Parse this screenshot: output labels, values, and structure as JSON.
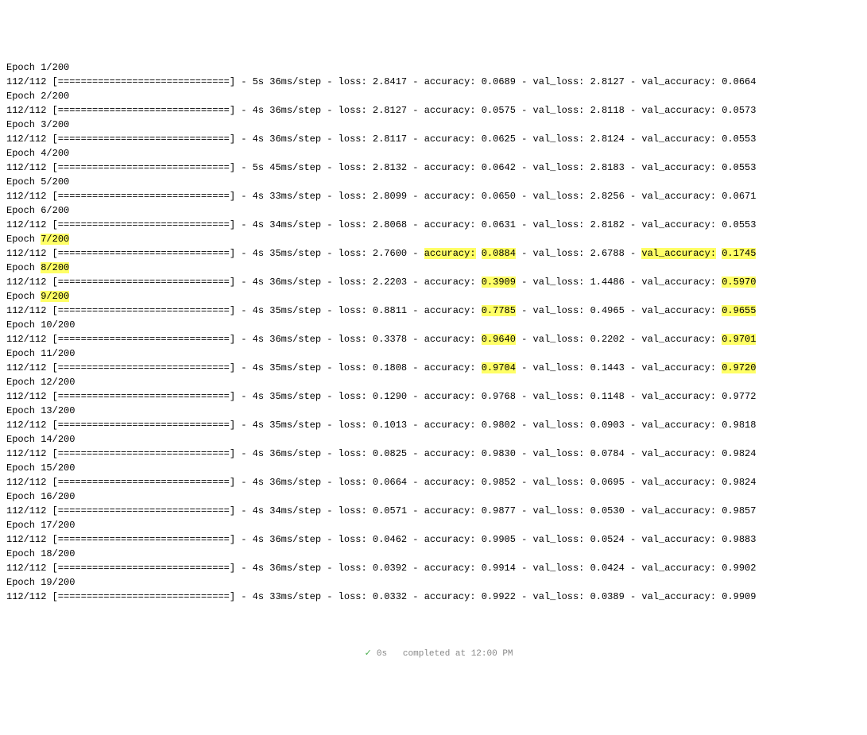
{
  "total_epochs": 200,
  "epochs": [
    {
      "n": 1,
      "hl_epoch": false,
      "progress": "112/112 [==============================]",
      "time": "5s 36ms/step",
      "loss": "2.8417",
      "acc": "0.0689",
      "val_loss": "2.8127",
      "val_acc": "0.0664",
      "hl_acc_label": false,
      "hl_acc": false,
      "hl_val_label": false,
      "hl_val": false
    },
    {
      "n": 2,
      "hl_epoch": false,
      "progress": "112/112 [==============================]",
      "time": "4s 36ms/step",
      "loss": "2.8127",
      "acc": "0.0575",
      "val_loss": "2.8118",
      "val_acc": "0.0573",
      "hl_acc_label": false,
      "hl_acc": false,
      "hl_val_label": false,
      "hl_val": false
    },
    {
      "n": 3,
      "hl_epoch": false,
      "progress": "112/112 [==============================]",
      "time": "4s 36ms/step",
      "loss": "2.8117",
      "acc": "0.0625",
      "val_loss": "2.8124",
      "val_acc": "0.0553",
      "hl_acc_label": false,
      "hl_acc": false,
      "hl_val_label": false,
      "hl_val": false
    },
    {
      "n": 4,
      "hl_epoch": false,
      "progress": "112/112 [==============================]",
      "time": "5s 45ms/step",
      "loss": "2.8132",
      "acc": "0.0642",
      "val_loss": "2.8183",
      "val_acc": "0.0553",
      "hl_acc_label": false,
      "hl_acc": false,
      "hl_val_label": false,
      "hl_val": false
    },
    {
      "n": 5,
      "hl_epoch": false,
      "progress": "112/112 [==============================]",
      "time": "4s 33ms/step",
      "loss": "2.8099",
      "acc": "0.0650",
      "val_loss": "2.8256",
      "val_acc": "0.0671",
      "hl_acc_label": false,
      "hl_acc": false,
      "hl_val_label": false,
      "hl_val": false
    },
    {
      "n": 6,
      "hl_epoch": false,
      "progress": "112/112 [==============================]",
      "time": "4s 34ms/step",
      "loss": "2.8068",
      "acc": "0.0631",
      "val_loss": "2.8182",
      "val_acc": "0.0553",
      "hl_acc_label": false,
      "hl_acc": false,
      "hl_val_label": false,
      "hl_val": false
    },
    {
      "n": 7,
      "hl_epoch": true,
      "progress": "112/112 [==============================]",
      "time": "4s 35ms/step",
      "loss": "2.7600",
      "acc": "0.0884",
      "val_loss": "2.6788",
      "val_acc": "0.1745",
      "hl_acc_label": true,
      "hl_acc": true,
      "hl_val_label": true,
      "hl_val": true
    },
    {
      "n": 8,
      "hl_epoch": true,
      "progress": "112/112 [==============================]",
      "time": "4s 36ms/step",
      "loss": "2.2203",
      "acc": "0.3909",
      "val_loss": "1.4486",
      "val_acc": "0.5970",
      "hl_acc_label": false,
      "hl_acc": true,
      "hl_val_label": false,
      "hl_val": true
    },
    {
      "n": 9,
      "hl_epoch": true,
      "progress": "112/112 [==============================]",
      "time": "4s 35ms/step",
      "loss": "0.8811",
      "acc": "0.7785",
      "val_loss": "0.4965",
      "val_acc": "0.9655",
      "hl_acc_label": false,
      "hl_acc": true,
      "hl_val_label": false,
      "hl_val": true
    },
    {
      "n": 10,
      "hl_epoch": false,
      "progress": "112/112 [==============================]",
      "time": "4s 36ms/step",
      "loss": "0.3378",
      "acc": "0.9640",
      "val_loss": "0.2202",
      "val_acc": "0.9701",
      "hl_acc_label": false,
      "hl_acc": true,
      "hl_val_label": false,
      "hl_val": true
    },
    {
      "n": 11,
      "hl_epoch": false,
      "progress": "112/112 [==============================]",
      "time": "4s 35ms/step",
      "loss": "0.1808",
      "acc": "0.9704",
      "val_loss": "0.1443",
      "val_acc": "0.9720",
      "hl_acc_label": false,
      "hl_acc": true,
      "hl_val_label": false,
      "hl_val": true
    },
    {
      "n": 12,
      "hl_epoch": false,
      "progress": "112/112 [==============================]",
      "time": "4s 35ms/step",
      "loss": "0.1290",
      "acc": "0.9768",
      "val_loss": "0.1148",
      "val_acc": "0.9772",
      "hl_acc_label": false,
      "hl_acc": false,
      "hl_val_label": false,
      "hl_val": false
    },
    {
      "n": 13,
      "hl_epoch": false,
      "progress": "112/112 [==============================]",
      "time": "4s 35ms/step",
      "loss": "0.1013",
      "acc": "0.9802",
      "val_loss": "0.0903",
      "val_acc": "0.9818",
      "hl_acc_label": false,
      "hl_acc": false,
      "hl_val_label": false,
      "hl_val": false
    },
    {
      "n": 14,
      "hl_epoch": false,
      "progress": "112/112 [==============================]",
      "time": "4s 36ms/step",
      "loss": "0.0825",
      "acc": "0.9830",
      "val_loss": "0.0784",
      "val_acc": "0.9824",
      "hl_acc_label": false,
      "hl_acc": false,
      "hl_val_label": false,
      "hl_val": false
    },
    {
      "n": 15,
      "hl_epoch": false,
      "progress": "112/112 [==============================]",
      "time": "4s 36ms/step",
      "loss": "0.0664",
      "acc": "0.9852",
      "val_loss": "0.0695",
      "val_acc": "0.9824",
      "hl_acc_label": false,
      "hl_acc": false,
      "hl_val_label": false,
      "hl_val": false
    },
    {
      "n": 16,
      "hl_epoch": false,
      "progress": "112/112 [==============================]",
      "time": "4s 34ms/step",
      "loss": "0.0571",
      "acc": "0.9877",
      "val_loss": "0.0530",
      "val_acc": "0.9857",
      "hl_acc_label": false,
      "hl_acc": false,
      "hl_val_label": false,
      "hl_val": false
    },
    {
      "n": 17,
      "hl_epoch": false,
      "progress": "112/112 [==============================]",
      "time": "4s 36ms/step",
      "loss": "0.0462",
      "acc": "0.9905",
      "val_loss": "0.0524",
      "val_acc": "0.9883",
      "hl_acc_label": false,
      "hl_acc": false,
      "hl_val_label": false,
      "hl_val": false
    },
    {
      "n": 18,
      "hl_epoch": false,
      "progress": "112/112 [==============================]",
      "time": "4s 36ms/step",
      "loss": "0.0392",
      "acc": "0.9914",
      "val_loss": "0.0424",
      "val_acc": "0.9902",
      "hl_acc_label": false,
      "hl_acc": false,
      "hl_val_label": false,
      "hl_val": false
    },
    {
      "n": 19,
      "hl_epoch": false,
      "progress": "112/112 [==============================]",
      "time": "4s 33ms/step",
      "loss": "0.0332",
      "acc": "0.9922",
      "val_loss": "0.0389",
      "val_acc": "0.9909",
      "hl_acc_label": false,
      "hl_acc": false,
      "hl_val_label": false,
      "hl_val": false
    }
  ],
  "footer": {
    "check": "✓",
    "text": "0s   completed at 12:00 PM"
  }
}
